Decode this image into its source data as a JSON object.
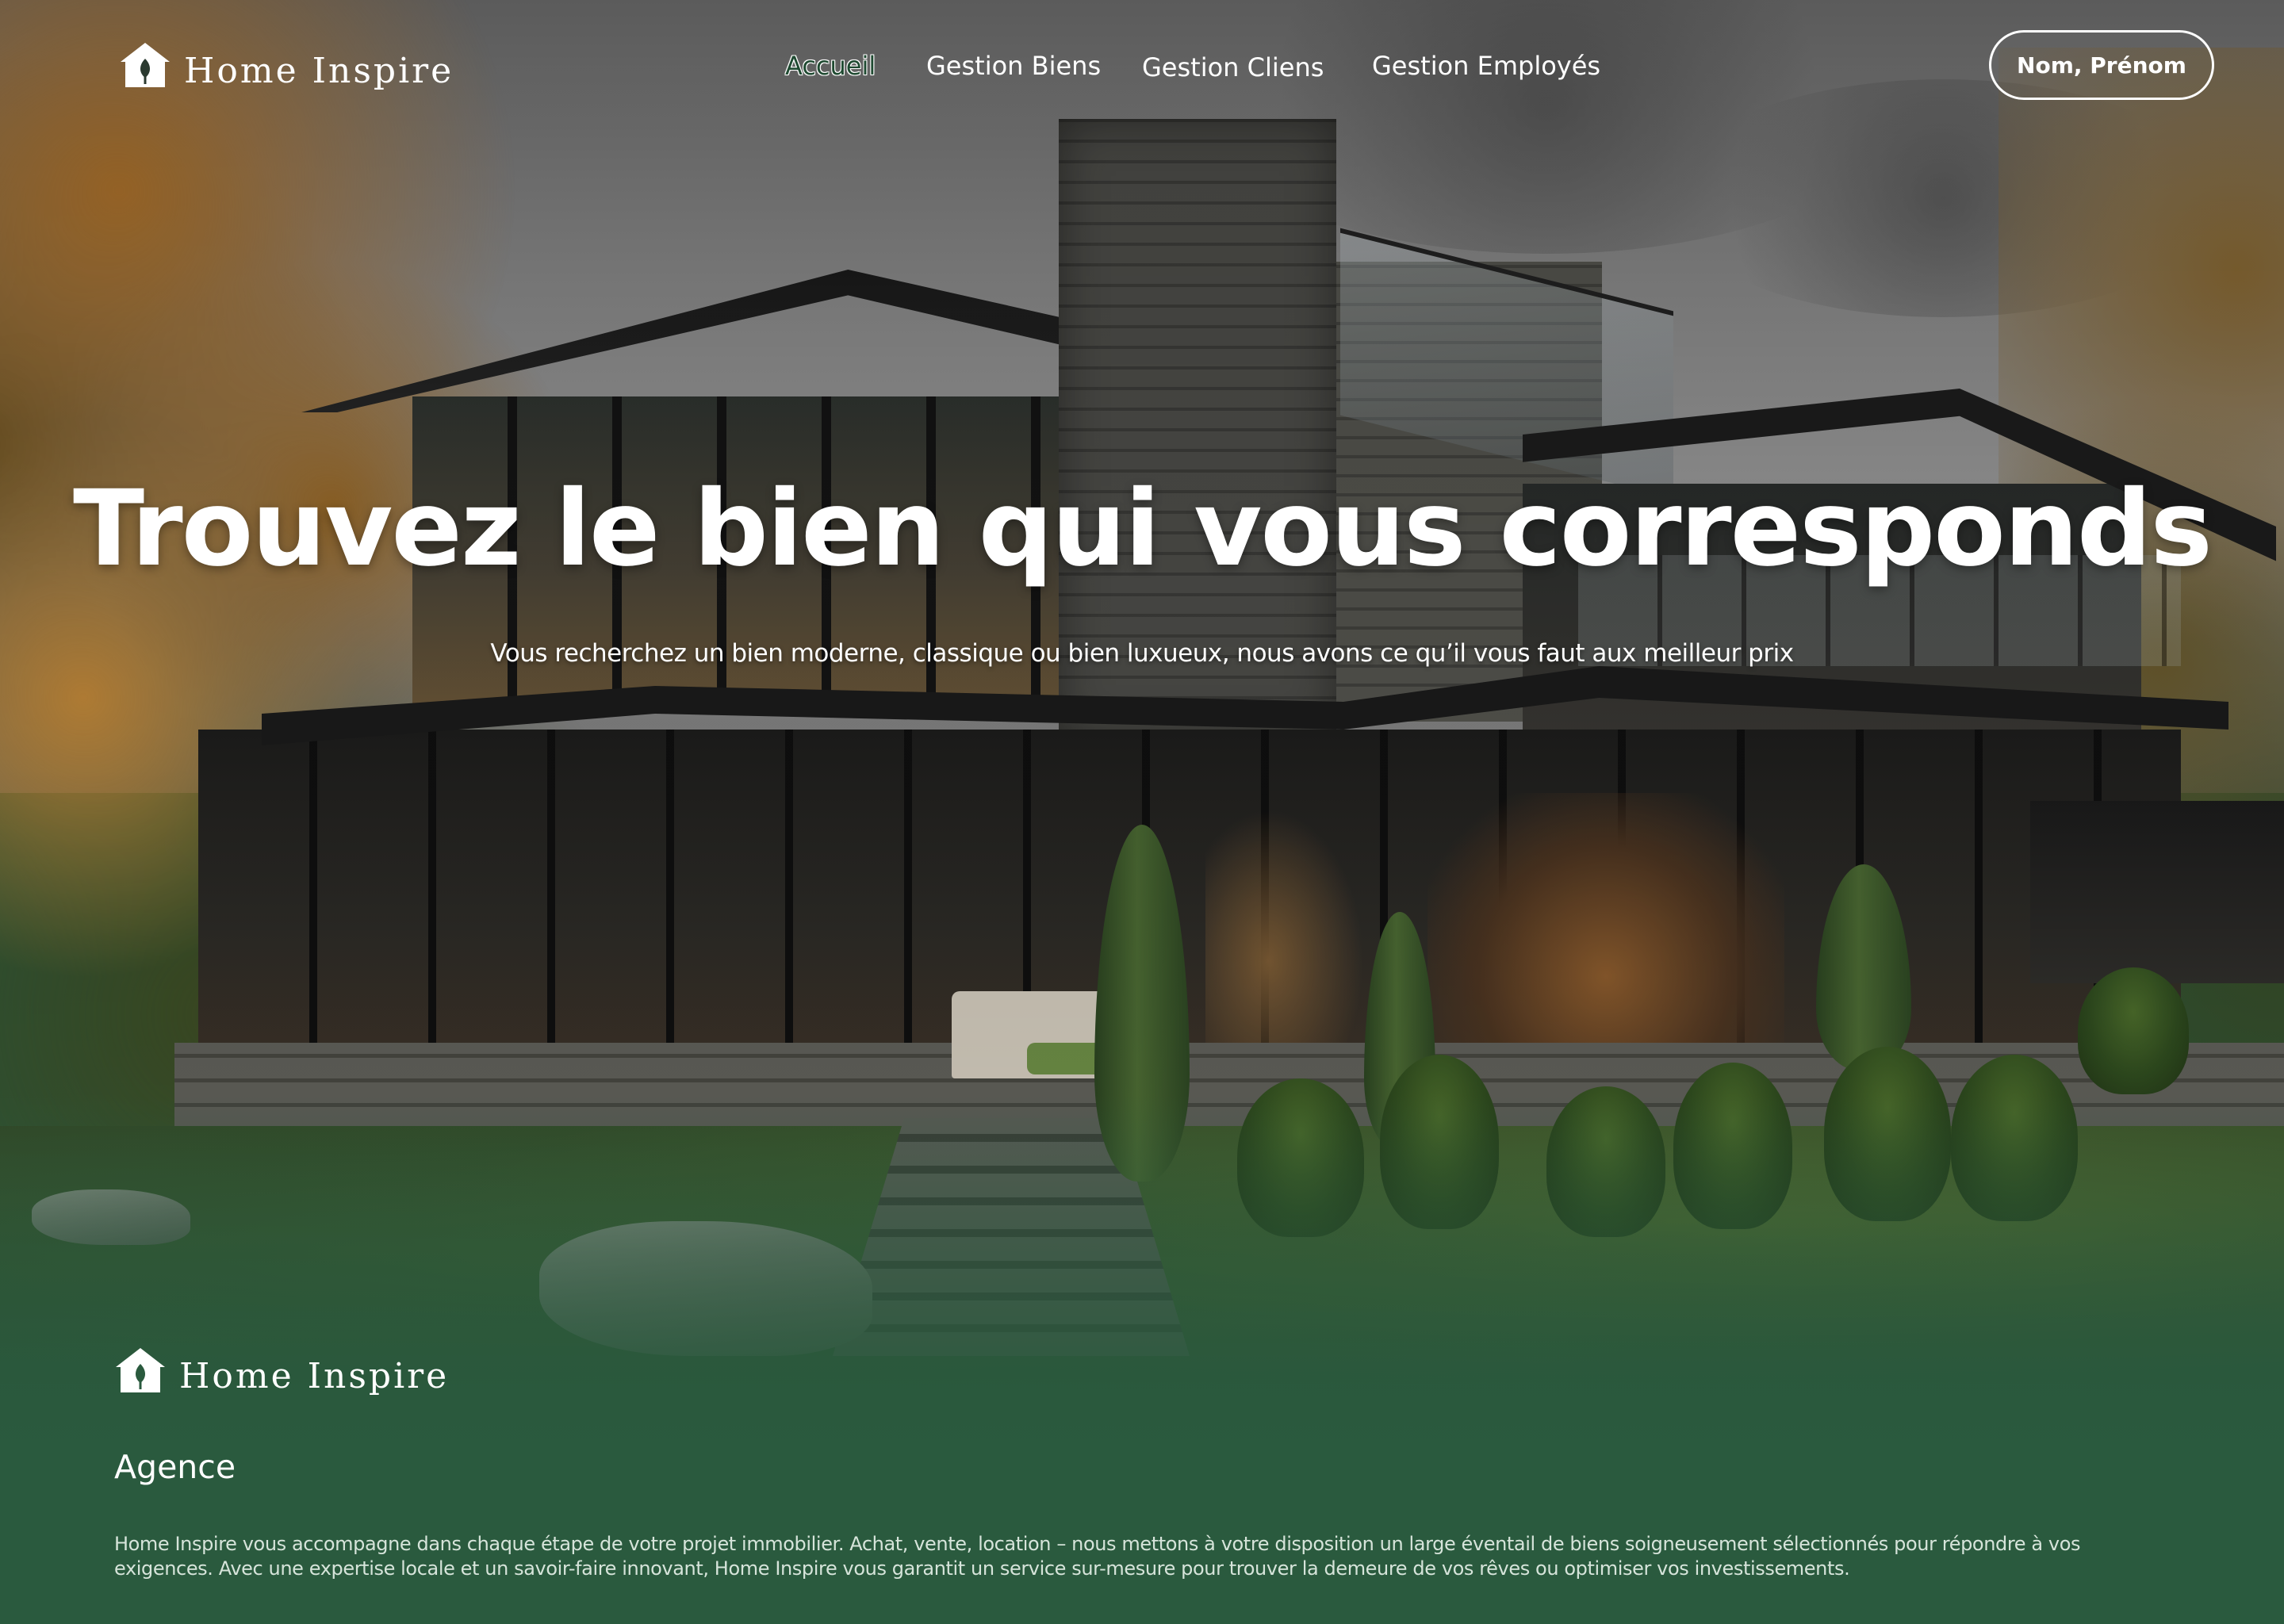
{
  "brand": {
    "name": "Home Inspire",
    "icon": "house-leaf-icon"
  },
  "nav": {
    "items": [
      {
        "label": "Accueil",
        "active": true
      },
      {
        "label": "Gestion Biens",
        "active": false
      },
      {
        "label": "Gestion Cliens",
        "active": false
      },
      {
        "label": "Gestion Employés",
        "active": false
      }
    ],
    "user_button": "Nom, Prénom"
  },
  "hero": {
    "title": "Trouvez le bien qui vous corresponds",
    "subtitle": "Vous recherchez un bien moderne, classique ou bien luxueux, nous avons ce qu’il vous faut aux meilleur prix"
  },
  "footer": {
    "brand_name": "Home Inspire",
    "heading": "Agence",
    "description": "Home Inspire vous accompagne dans chaque étape de votre projet immobilier. Achat, vente, location – nous mettons à votre disposition un large éventail de biens soigneusement sélectionnés pour répondre à vos exigences. Avec une expertise locale et un savoir-faire innovant, Home Inspire vous garantit un service sur-mesure pour trouver la demeure de vos rêves ou optimiser vos investissements."
  },
  "colors": {
    "footer_green": "#2a5a3e",
    "active_nav_text": "#1f4a31",
    "text_white": "#ffffff"
  }
}
